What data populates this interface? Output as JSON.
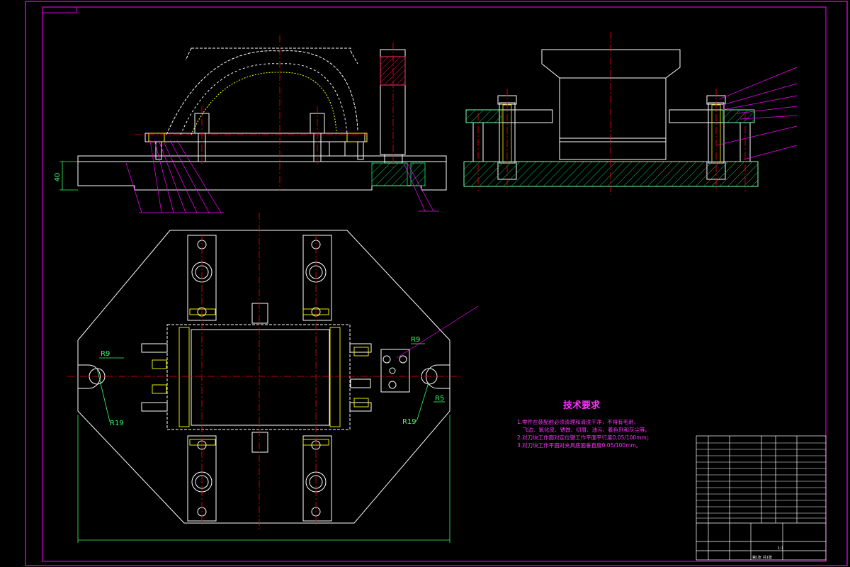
{
  "drawing": {
    "tech_requirements": {
      "title": "技术要求",
      "lines": [
        "1.零件在装配前必须清理和清洗干净，不得有毛刺、",
        "飞边、氧化皮、锈蚀、切屑、油污、着色剂和灰尘等。",
        "2.对刀块工作面对定位键工作平面平行度0.05/100mm；",
        "3.对刀块工作平面对夹具底面垂直度0.05/100mm。"
      ]
    },
    "dimensions": {
      "height_40": "40",
      "r9_left": "R9",
      "r19_left": "R19",
      "r9_right": "R9",
      "r19_right": "R19",
      "r5": "R5"
    },
    "title_block": {
      "scale": "1:1",
      "sheet": "第1张 共1张"
    },
    "colors": {
      "background": "#000000",
      "frame": "#ff00ff",
      "outline": "#ffffff",
      "center": "#ff0000",
      "hatch": "#00ff66",
      "thread": "#ffff00",
      "text": "#ff33ff"
    }
  }
}
